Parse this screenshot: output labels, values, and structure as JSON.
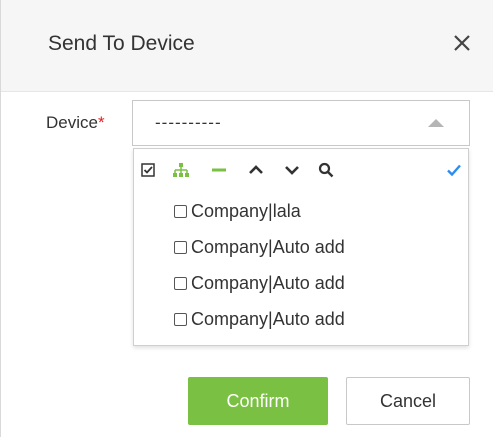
{
  "dialog": {
    "title": "Send To Device",
    "close_icon": "close-icon"
  },
  "form": {
    "device_label": "Device",
    "required_mark": "*",
    "device_value": "----------"
  },
  "dropdown": {
    "toolbar_icons": [
      "select-all-icon",
      "tree-icon",
      "collapse-icon",
      "chevron-up-icon",
      "chevron-down-icon",
      "search-icon",
      "check-icon"
    ],
    "options": [
      {
        "label": "Company|lala"
      },
      {
        "label": "Company|Auto add"
      },
      {
        "label": "Company|Auto add"
      },
      {
        "label": "Company|Auto add"
      }
    ]
  },
  "buttons": {
    "confirm_label": "Confirm",
    "cancel_label": "Cancel"
  },
  "colors": {
    "accent_green": "#7ac143",
    "check_blue": "#2d8cf0",
    "required_red": "#e02020"
  }
}
